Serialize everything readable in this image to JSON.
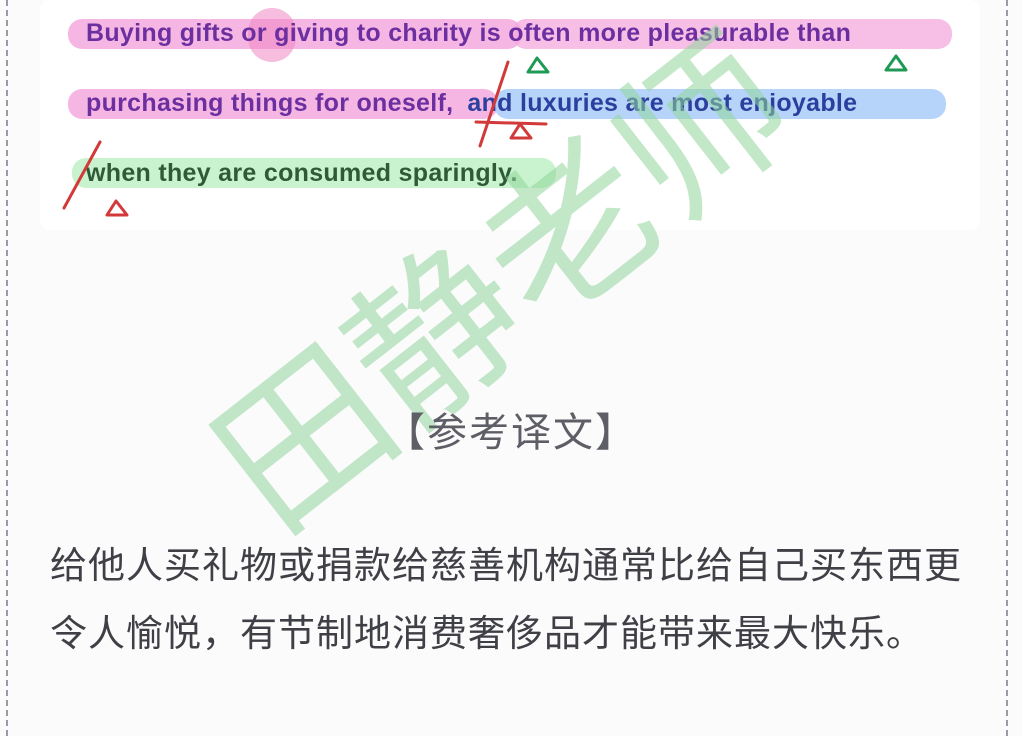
{
  "english": {
    "line1_pink": "Buying gifts or giving to charity",
    "line1_rest": " is often more pleasurable than",
    "line2_pink": "purchasing things for oneself,",
    "line2_blue": "and luxuries are most enjoyable",
    "line3_green": "when they are consumed sparingly."
  },
  "watermark": {
    "text": "田静老师",
    "color": "#8fd69a"
  },
  "section": {
    "title": "【参考译文】"
  },
  "translation": {
    "text": "给他人买礼物或捐款给慈善机构通常比给自己买东西更令人愉悦，有节制地消费奢侈品才能带来最大快乐。"
  },
  "colors": {
    "highlight_pink": "#f4a9de",
    "highlight_blue": "#a9cdf8",
    "highlight_green": "#c2f2c9",
    "mark_red": "#d23a3a",
    "mark_green": "#1e9a55"
  }
}
